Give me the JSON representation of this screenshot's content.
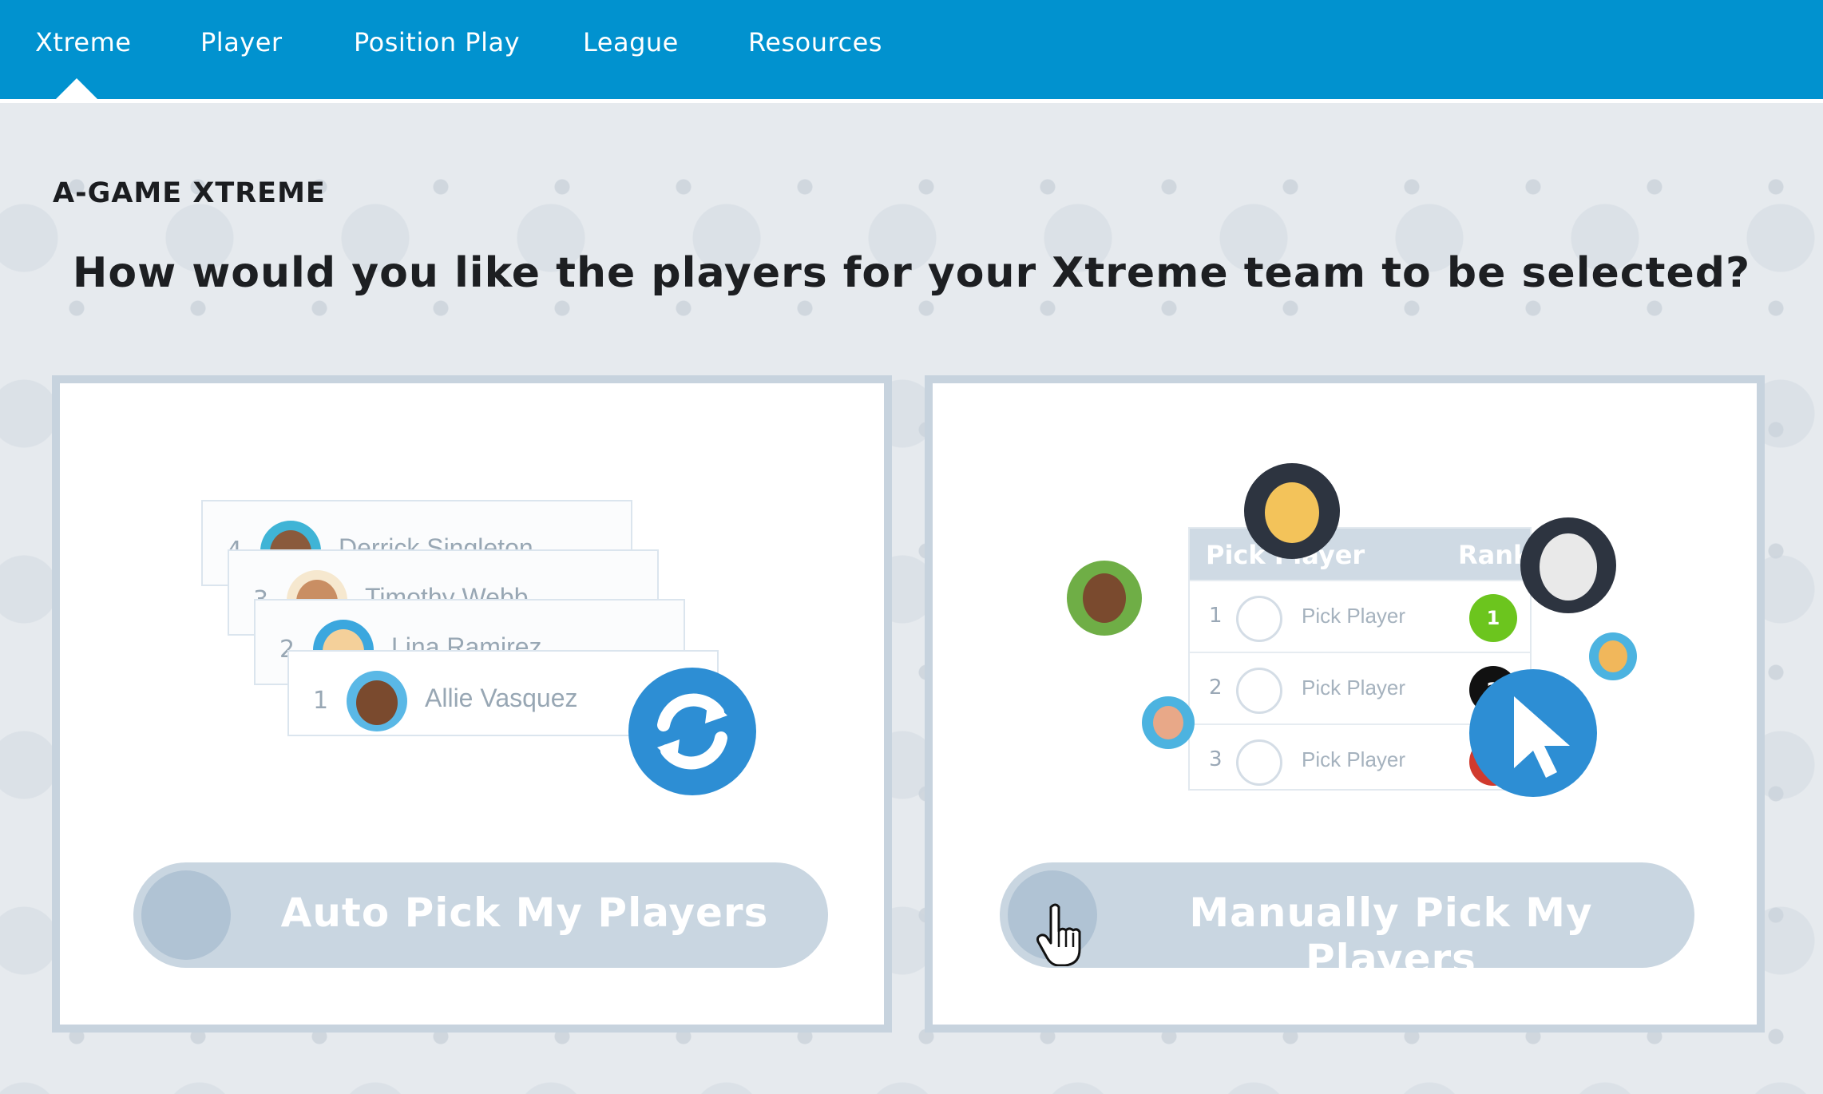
{
  "nav": {
    "items": [
      {
        "label": "Xtreme",
        "active": true
      },
      {
        "label": "Player",
        "active": false
      },
      {
        "label": "Position Play",
        "active": false
      },
      {
        "label": "League",
        "active": false
      },
      {
        "label": "Resources",
        "active": false
      }
    ]
  },
  "page": {
    "title": "A-GAME XTREME",
    "question": "How would you like the players for your Xtreme team to be selected?"
  },
  "auto_card": {
    "rows": [
      {
        "num": "4",
        "name": "Derrick Singleton"
      },
      {
        "num": "3",
        "name": "Timothy Webb"
      },
      {
        "num": "2",
        "name": "Lina Ramirez"
      },
      {
        "num": "1",
        "name": "Allie Vasquez"
      }
    ],
    "badge_icon": "refresh-icon",
    "button_label": "Auto Pick My Players"
  },
  "manual_card": {
    "table_header": {
      "col1": "Pick Player",
      "col2": "Rank"
    },
    "rows": [
      {
        "num": "1",
        "label": "Pick Player",
        "rank": "1",
        "rank_color": "#6cc51e"
      },
      {
        "num": "2",
        "label": "Pick Player",
        "rank": "2",
        "rank_color": "#111111"
      },
      {
        "num": "3",
        "label": "Pick Player",
        "rank": "",
        "rank_color": "#d03a2e"
      }
    ],
    "badge_icon": "cursor-arrow-icon",
    "button_label": "Manually Pick My Players"
  },
  "colors": {
    "nav_blue": "#0192cf",
    "accent_blue": "#2d8ed4",
    "button_bg": "#c9d6e1",
    "card_border": "#c7d3de"
  }
}
